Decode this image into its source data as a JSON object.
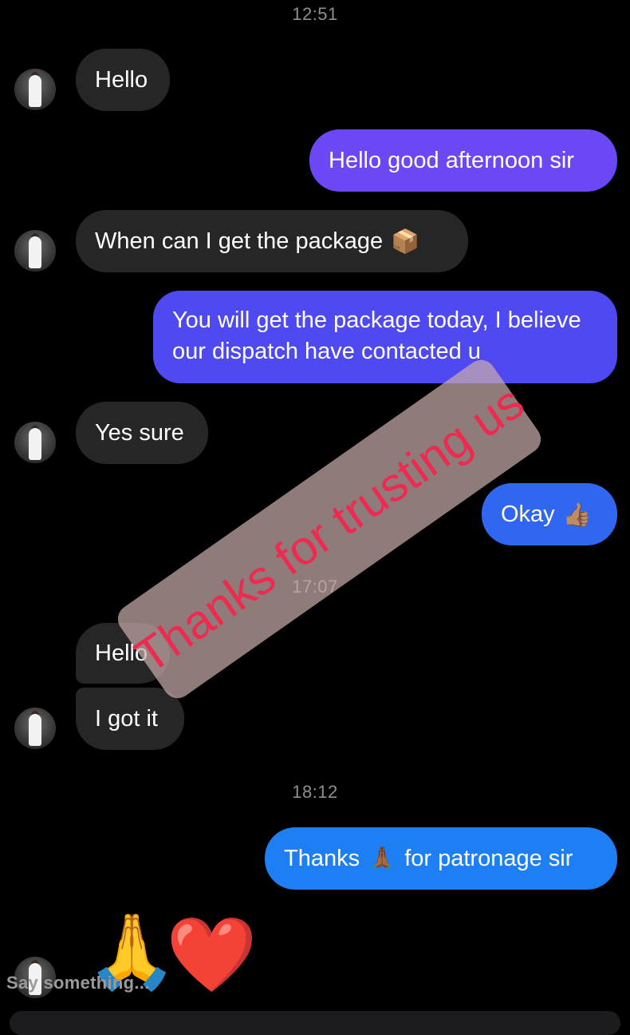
{
  "timestamps": [
    "12:51",
    "17:07",
    "18:12"
  ],
  "messages": {
    "m1": "Hello",
    "m2": "Hello good afternoon sir",
    "m3_text": "When can I get the package",
    "m3_emoji": "📦",
    "m4": "You will get the package today, I believe our dispatch have contacted u",
    "m5": "Yes sure",
    "m6_text": "Okay",
    "m6_emoji": "👍🏽",
    "m7": "Hello",
    "m8": "I got it",
    "m9_a": "Thanks",
    "m9_emoji": "🙏🏾",
    "m9_b": "for patronage sir"
  },
  "reactions": {
    "pray": "🙏",
    "heart": "❤️"
  },
  "watermark": "Thanks for trusting us",
  "composer_placeholder": "Say something...",
  "colors": {
    "incoming_bubble": "#262626",
    "outgoing_purple": "#6b47f5",
    "outgoing_indigo": "#4f49f2",
    "outgoing_blue": "#2f67f0",
    "outgoing_bright_blue": "#1e7ff5",
    "watermark_text": "#ee2a4e"
  }
}
